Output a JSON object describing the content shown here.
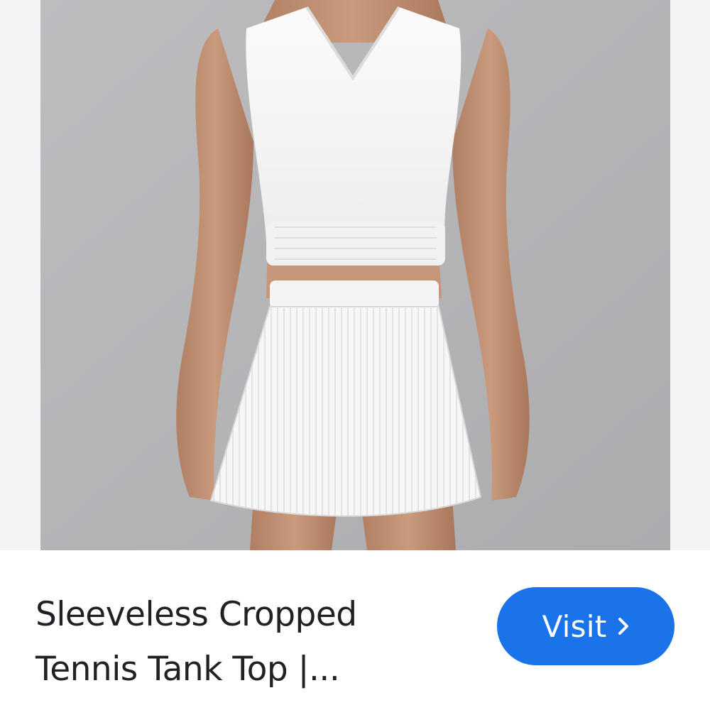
{
  "result_card": {
    "image": {
      "alt": "Sleeveless Cropped Tennis Tank Top",
      "background_color": "#b9b9bc",
      "side_color": "#f3f3f5"
    },
    "title_lines": [
      "Sleeveless Cropped",
      "Tennis Tank Top |..."
    ],
    "visit_button": {
      "label": "Visit",
      "icon": "chevron-right-icon",
      "color": "#1a73e8"
    }
  }
}
